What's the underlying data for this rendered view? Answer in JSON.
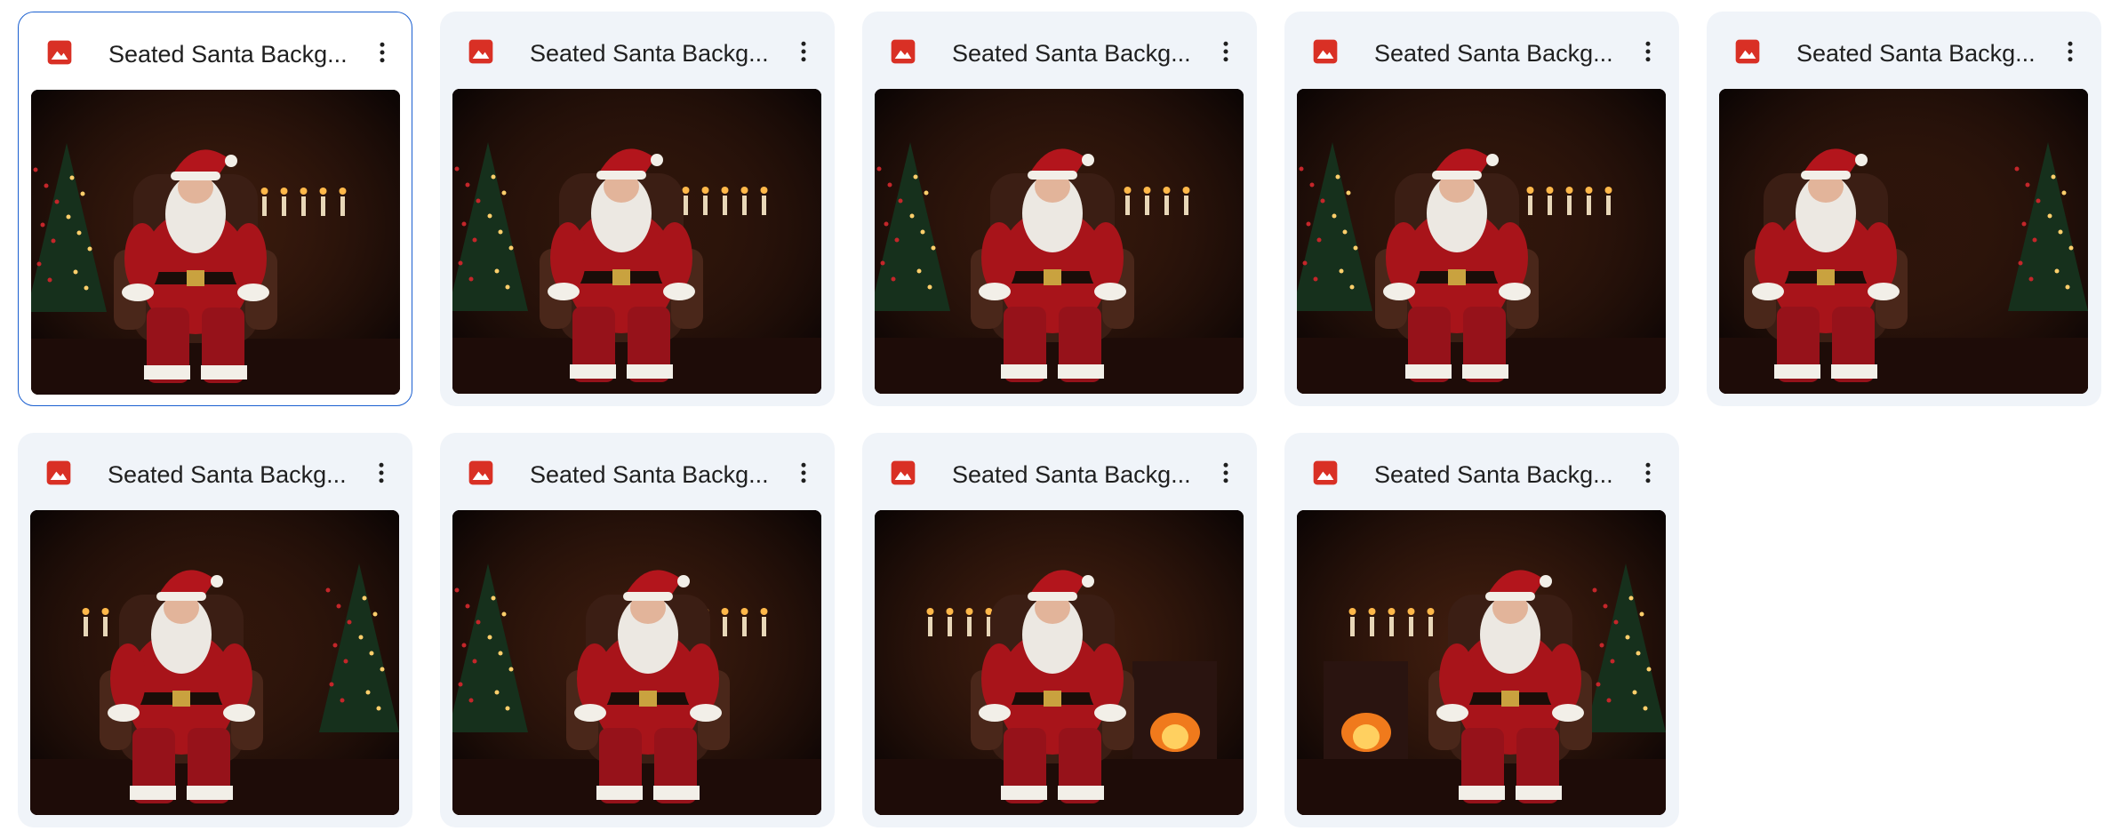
{
  "files": [
    {
      "name": "Seated Santa Backg...",
      "selected": true,
      "type_icon": "image-icon"
    },
    {
      "name": "Seated Santa Backg...",
      "selected": false,
      "type_icon": "image-icon"
    },
    {
      "name": "Seated Santa Backg...",
      "selected": false,
      "type_icon": "image-icon"
    },
    {
      "name": "Seated Santa Backg...",
      "selected": false,
      "type_icon": "image-icon"
    },
    {
      "name": "Seated Santa Backg...",
      "selected": false,
      "type_icon": "image-icon"
    },
    {
      "name": "Seated Santa Backg...",
      "selected": false,
      "type_icon": "image-icon"
    },
    {
      "name": "Seated Santa Backg...",
      "selected": false,
      "type_icon": "image-icon"
    },
    {
      "name": "Seated Santa Backg...",
      "selected": false,
      "type_icon": "image-icon"
    },
    {
      "name": "Seated Santa Backg...",
      "selected": false,
      "type_icon": "image-icon"
    }
  ],
  "colors": {
    "image_icon": "#d93025",
    "selected_border": "#1a5fd0",
    "card_bg": "#f0f4f9"
  },
  "more_icon": "more-vert-icon"
}
